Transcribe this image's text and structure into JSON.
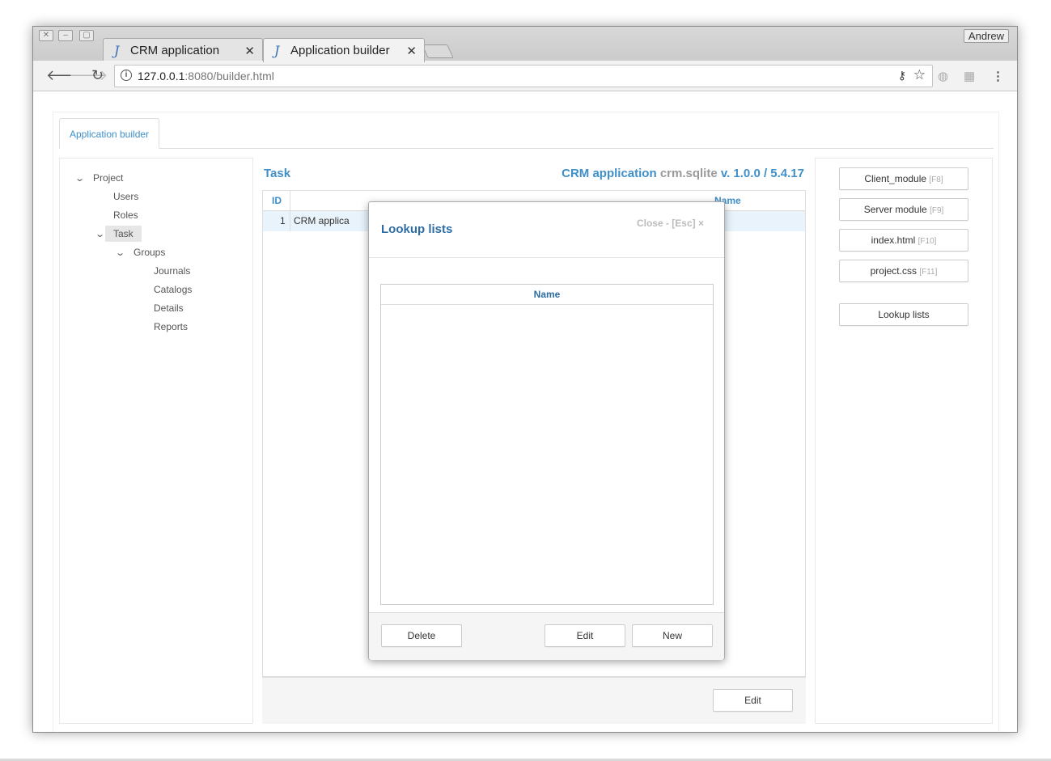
{
  "browser": {
    "tabs": [
      {
        "label": "CRM application",
        "icon": "J"
      },
      {
        "label": "Application builder",
        "icon": "J"
      }
    ],
    "user": "Andrew",
    "url_host": "127.0.0.1",
    "url_rest": ":8080/builder.html"
  },
  "page": {
    "tab_label": "Application builder",
    "tree": {
      "project": "Project",
      "users": "Users",
      "roles": "Roles",
      "task": "Task",
      "groups": "Groups",
      "journals": "Journals",
      "catalogs": "Catalogs",
      "details": "Details",
      "reports": "Reports"
    },
    "main": {
      "title": "Task",
      "app_name": "CRM application",
      "db_name": "crm.sqlite",
      "version": "v. 1.0.0 / 5.4.17",
      "columns": {
        "id": "ID",
        "name": "Name"
      },
      "rows": [
        {
          "id": "1",
          "caption": "CRM applica"
        }
      ],
      "edit_label": "Edit"
    },
    "right": {
      "client_module": "Client_module",
      "client_module_key": "[F8]",
      "server_module": "Server module",
      "server_module_key": "[F9]",
      "index_html": "index.html",
      "index_html_key": "[F10]",
      "project_css": "project.css",
      "project_css_key": "[F11]",
      "lookup_lists": "Lookup lists"
    }
  },
  "modal": {
    "title": "Lookup lists",
    "close": "Close - [Esc] ×",
    "column": "Name",
    "delete": "Delete",
    "edit": "Edit",
    "new": "New"
  }
}
